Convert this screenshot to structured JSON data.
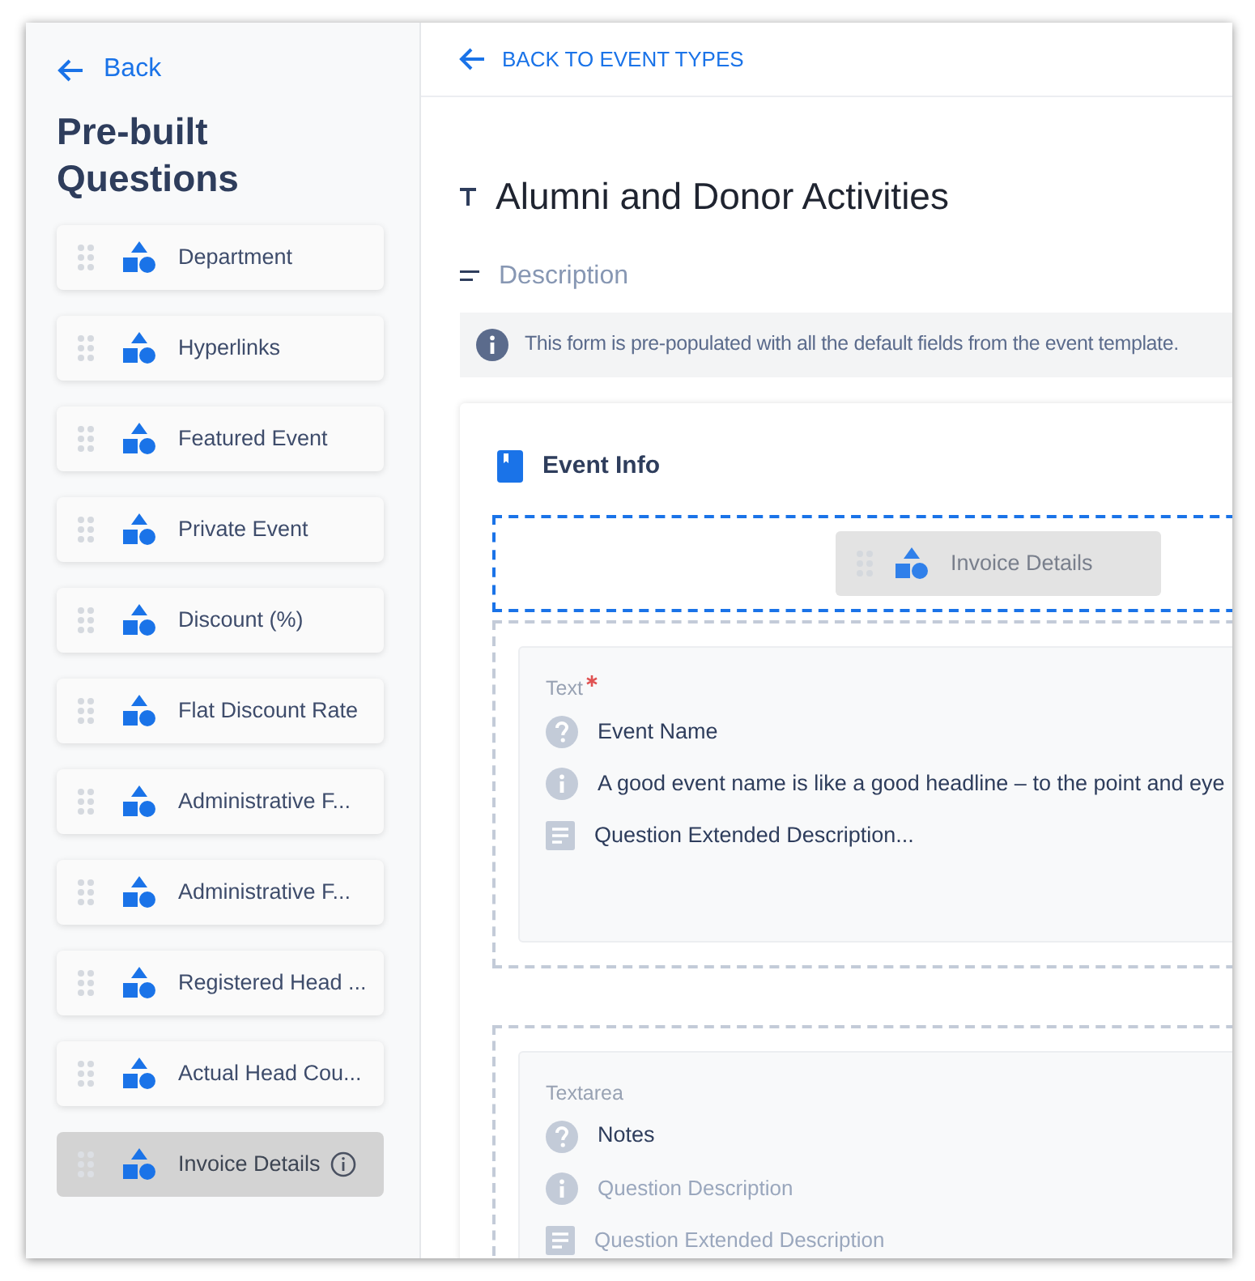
{
  "sidebar": {
    "back_link": "Back",
    "title": "Pre-built Questions",
    "items": [
      {
        "label": "Department",
        "dragging": false
      },
      {
        "label": "Hyperlinks",
        "dragging": false
      },
      {
        "label": "Featured Event",
        "dragging": false
      },
      {
        "label": "Private Event",
        "dragging": false
      },
      {
        "label": "Discount (%)",
        "dragging": false
      },
      {
        "label": "Flat Discount Rate",
        "dragging": false
      },
      {
        "label": "Administrative F...",
        "dragging": false
      },
      {
        "label": "Administrative F...",
        "dragging": false
      },
      {
        "label": "Registered Head ...",
        "dragging": false
      },
      {
        "label": "Actual Head Cou...",
        "dragging": false
      },
      {
        "label": "Invoice Details",
        "dragging": true
      }
    ]
  },
  "header": {
    "back_link": "BACK TO EVENT TYPES"
  },
  "form": {
    "title": "Alumni and Donor Activities",
    "description_label": "Description",
    "notice": "This form is pre-populated with all the default fields from the event template.",
    "section": {
      "title": "Event Info",
      "drop_zone": {
        "label": "Invoice Details"
      },
      "questions": [
        {
          "type": "Text",
          "required": true,
          "lines": [
            {
              "kind": "name",
              "text": "Event Name",
              "empty": false
            },
            {
              "kind": "description",
              "text": "A good event name is like a good headline – to the point and eye",
              "empty": false
            },
            {
              "kind": "extended",
              "text": "Question Extended Description...",
              "empty": false
            }
          ]
        },
        {
          "type": "Textarea",
          "required": false,
          "lines": [
            {
              "kind": "name",
              "text": "Notes",
              "empty": false
            },
            {
              "kind": "description",
              "text": "Question Description",
              "empty": true
            },
            {
              "kind": "extended",
              "text": "Question Extended Description",
              "empty": true
            }
          ]
        }
      ]
    }
  }
}
